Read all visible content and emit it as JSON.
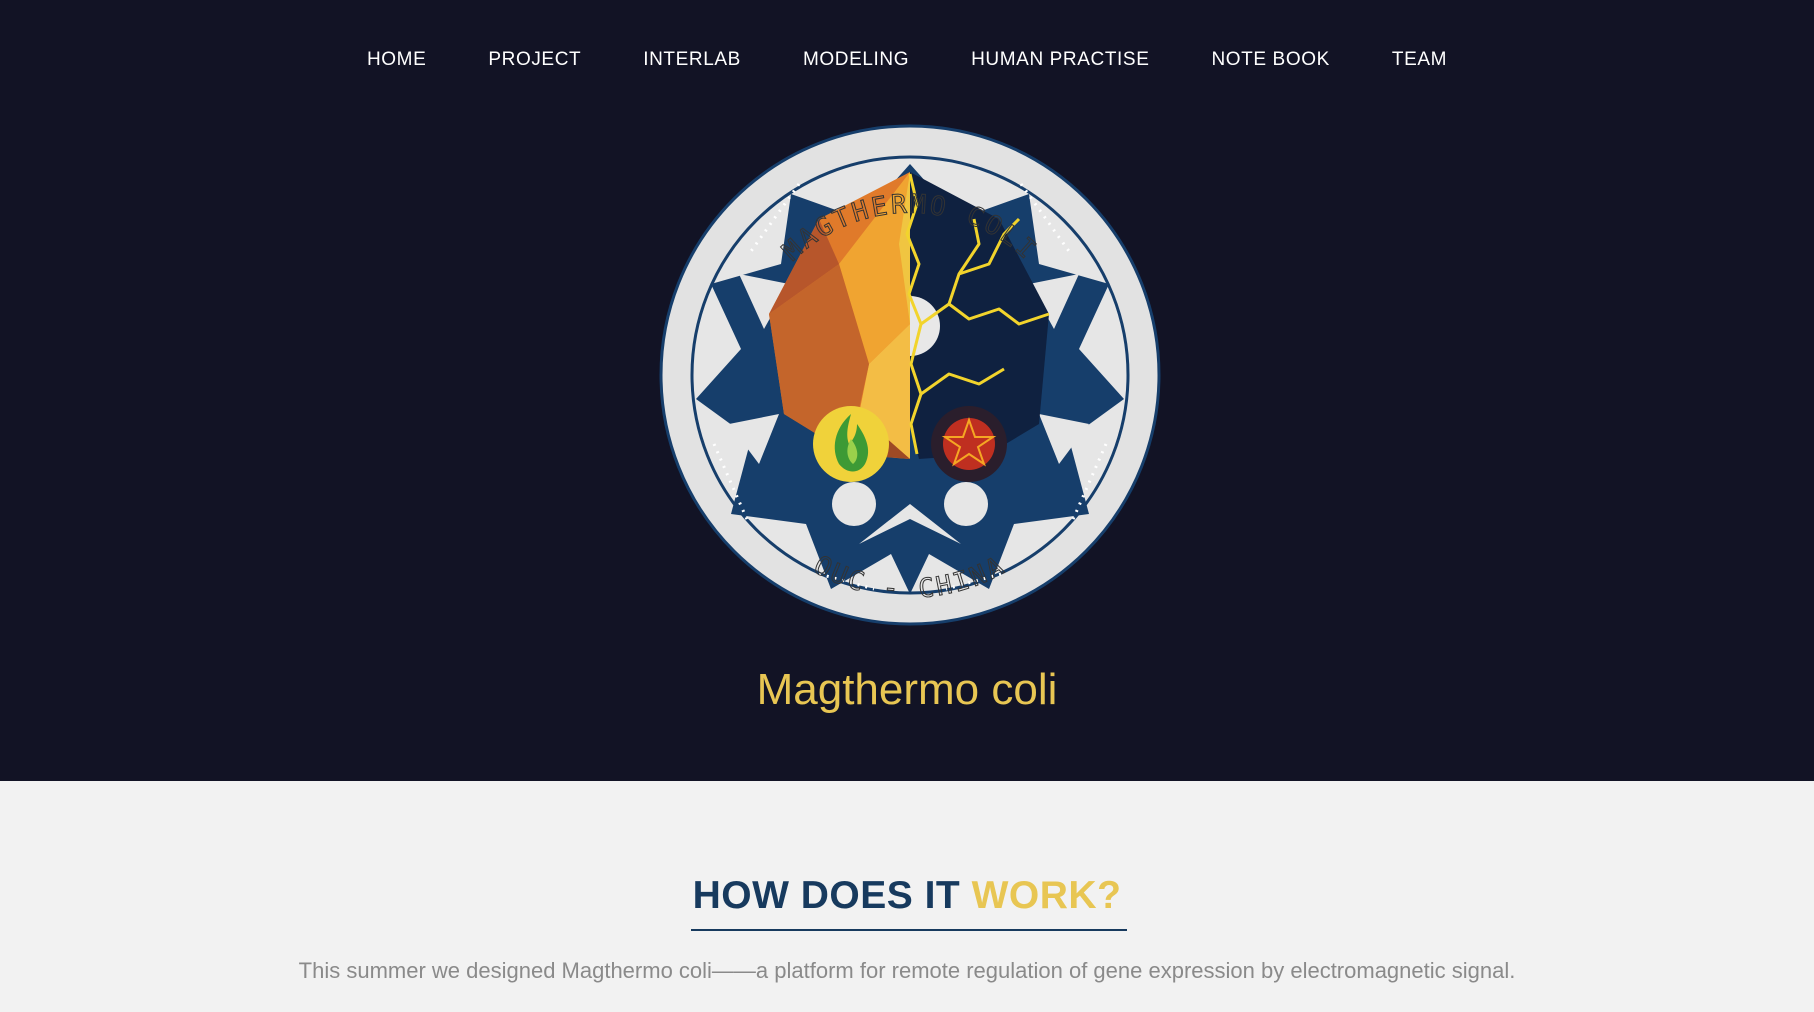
{
  "nav": {
    "items": [
      {
        "label": "HOME"
      },
      {
        "label": "PROJECT"
      },
      {
        "label": "INTERLAB"
      },
      {
        "label": "MODELING"
      },
      {
        "label": "HUMAN PRACTISE"
      },
      {
        "label": "NOTE BOOK"
      },
      {
        "label": "TEAM"
      }
    ]
  },
  "logo": {
    "icon": "magthermo-coli-team-logo",
    "top_text": "MAGTHERMO COLI",
    "bottom_text": "OUC - CHINA",
    "colors": {
      "ring": "#e2e2e2",
      "navy": "#163e6b",
      "orange": "#e07a2a",
      "yellow": "#f0c541",
      "dark": "#0f2140",
      "lightning": "#f2d42c",
      "flame": "#6bbf3f",
      "star": "#d9321f"
    }
  },
  "hero": {
    "title": "Magthermo coli"
  },
  "section": {
    "title_part1": "HOW DOES IT ",
    "title_part2": "WORK?",
    "description": "This summer we designed Magthermo coli——a platform for remote regulation of gene expression by electromagnetic signal."
  },
  "colors": {
    "hero_bg": "#121325",
    "accent_yellow": "#e8c653",
    "heading_navy": "#173a5e",
    "page_bg": "#f2f2f2",
    "body_text": "#8a8a8a"
  }
}
